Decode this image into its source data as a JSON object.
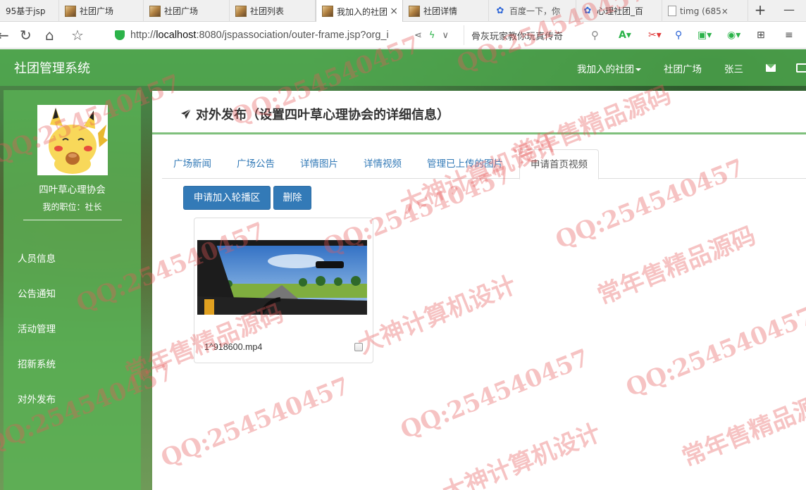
{
  "browser": {
    "tabs": [
      {
        "label": "95基于jsp",
        "icon": "page-icon"
      },
      {
        "label": "社团广场",
        "icon": "page-icon"
      },
      {
        "label": "社团广场",
        "icon": "page-icon"
      },
      {
        "label": "社团列表",
        "icon": "page-icon"
      },
      {
        "label": "我加入的社团",
        "icon": "page-icon",
        "active": true
      },
      {
        "label": "社团详情",
        "icon": "page-icon"
      },
      {
        "label": "百度一下，你",
        "icon": "baidu-paw-icon"
      },
      {
        "label": "心理社团_百",
        "icon": "baidu-paw-icon"
      },
      {
        "label": "timg (685×",
        "icon": "document-icon"
      }
    ],
    "url_prefix": "http://",
    "url_host": "localhost",
    "url_rest": ":8080/jspassociation/outer-frame.jsp?org_i",
    "search_text": "骨灰玩家教你玩真传奇"
  },
  "app": {
    "brand": "社团管理系统",
    "nav": {
      "joined": "我加入的社团",
      "square": "社团广场",
      "user": "张三"
    }
  },
  "sidebar": {
    "org_name": "四叶草心理协会",
    "role_label": "我的职位：社长",
    "items": [
      "人员信息",
      "公告通知",
      "活动管理",
      "招新系统",
      "对外发布"
    ]
  },
  "main": {
    "title": "对外发布（设置四叶草心理协会的详细信息）",
    "tabs": [
      "广场新闻",
      "广场公告",
      "详情图片",
      "详情视频",
      "管理已上传的图片",
      "申请首页视频"
    ],
    "active_tab": "申请首页视频",
    "buttons": {
      "apply": "申请加入轮播区",
      "delete": "删除"
    },
    "videos": [
      {
        "filename": "1^918600.mp4",
        "checked": false
      }
    ]
  },
  "watermark": {
    "qq": "QQ:254540457",
    "phrase1": "常年售精品源码",
    "phrase2": "大神计算机设计"
  },
  "colors": {
    "navbar": "#50af50",
    "sidebar": "#5ab455",
    "primary_button": "#337ab7",
    "link": "#337ab7",
    "title_rule": "#7fc07c"
  }
}
